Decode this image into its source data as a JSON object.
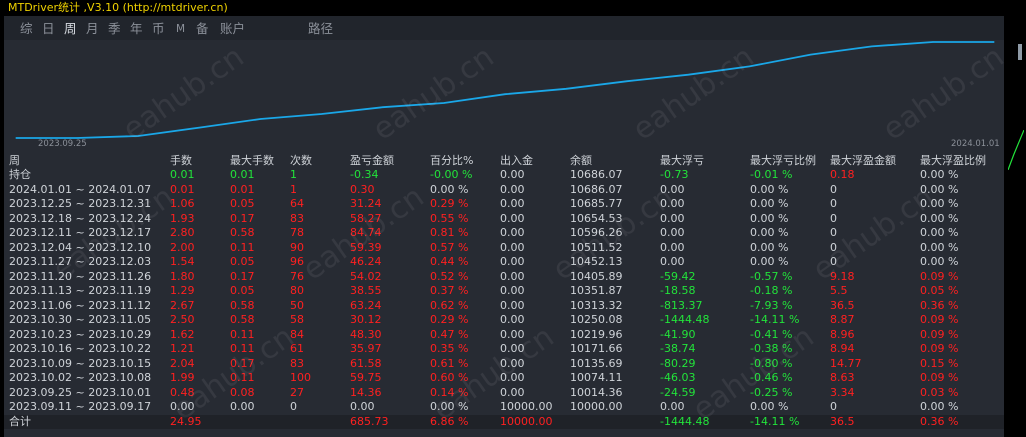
{
  "window": {
    "title": "MTDriver统计 ,V3.10 (http://mtdriver.cn)"
  },
  "tabs": [
    {
      "label": "综"
    },
    {
      "label": "日"
    },
    {
      "label": "周",
      "active": true
    },
    {
      "label": "月"
    },
    {
      "label": "季"
    },
    {
      "label": "年"
    },
    {
      "label": "币"
    },
    {
      "label": "M"
    },
    {
      "label": "备"
    },
    {
      "label": "账户"
    },
    {
      "label": "路径"
    }
  ],
  "chart_data": {
    "type": "line",
    "x_tick_labels": [
      "2023.09.25",
      "2024.01.01"
    ],
    "x": [
      "2023.09.11",
      "2023.09.25",
      "2023.10.02",
      "2023.10.09",
      "2023.10.16",
      "2023.10.23",
      "2023.10.30",
      "2023.11.06",
      "2023.11.13",
      "2023.11.20",
      "2023.11.27",
      "2023.12.04",
      "2023.12.11",
      "2023.12.18",
      "2023.12.25",
      "2024.01.01"
    ],
    "values": [
      10000.0,
      10000.0,
      10014.36,
      10074.11,
      10135.69,
      10171.66,
      10219.96,
      10250.08,
      10313.32,
      10351.87,
      10405.89,
      10452.13,
      10511.52,
      10596.26,
      10654.53,
      10685.77,
      10686.07
    ],
    "color": "#1aa7e8"
  },
  "table": {
    "headers": [
      "周",
      "手数",
      "最大手数",
      "次数",
      "盈亏金额",
      "百分比%",
      "出入金",
      "余额",
      "最大浮亏",
      "最大浮亏比例",
      "最大浮盈金额",
      "最大浮盈比例"
    ],
    "position_row": [
      "持仓",
      "0.01",
      "0.01",
      "1",
      "-0.34",
      "-0.00 %",
      "0.00",
      "10686.07",
      "-0.73",
      "-0.01 %",
      "0.18",
      "0.00 %"
    ],
    "rows": [
      [
        "2024.01.01 ~ 2024.01.07",
        "0.01",
        "0.01",
        "1",
        "0.30",
        "0.00 %",
        "0.00",
        "10686.07",
        "0.00",
        "0.00 %",
        "0",
        "0.00 %"
      ],
      [
        "2023.12.25 ~ 2023.12.31",
        "1.06",
        "0.05",
        "64",
        "31.24",
        "0.29 %",
        "0.00",
        "10685.77",
        "0.00",
        "0.00 %",
        "0",
        "0.00 %"
      ],
      [
        "2023.12.18 ~ 2023.12.24",
        "1.93",
        "0.17",
        "83",
        "58.27",
        "0.55 %",
        "0.00",
        "10654.53",
        "0.00",
        "0.00 %",
        "0",
        "0.00 %"
      ],
      [
        "2023.12.11 ~ 2023.12.17",
        "2.80",
        "0.58",
        "78",
        "84.74",
        "0.81 %",
        "0.00",
        "10596.26",
        "0.00",
        "0.00 %",
        "0",
        "0.00 %"
      ],
      [
        "2023.12.04 ~ 2023.12.10",
        "2.00",
        "0.11",
        "90",
        "59.39",
        "0.57 %",
        "0.00",
        "10511.52",
        "0.00",
        "0.00 %",
        "0",
        "0.00 %"
      ],
      [
        "2023.11.27 ~ 2023.12.03",
        "1.54",
        "0.05",
        "96",
        "46.24",
        "0.44 %",
        "0.00",
        "10452.13",
        "0.00",
        "0.00 %",
        "0",
        "0.00 %"
      ],
      [
        "2023.11.20 ~ 2023.11.26",
        "1.80",
        "0.17",
        "76",
        "54.02",
        "0.52 %",
        "0.00",
        "10405.89",
        "-59.42",
        "-0.57 %",
        "9.18",
        "0.09 %"
      ],
      [
        "2023.11.13 ~ 2023.11.19",
        "1.29",
        "0.05",
        "80",
        "38.55",
        "0.37 %",
        "0.00",
        "10351.87",
        "-18.58",
        "-0.18 %",
        "5.5",
        "0.05 %"
      ],
      [
        "2023.11.06 ~ 2023.11.12",
        "2.67",
        "0.58",
        "50",
        "63.24",
        "0.62 %",
        "0.00",
        "10313.32",
        "-813.37",
        "-7.93 %",
        "36.5",
        "0.36 %"
      ],
      [
        "2023.10.30 ~ 2023.11.05",
        "2.50",
        "0.58",
        "58",
        "30.12",
        "0.29 %",
        "0.00",
        "10250.08",
        "-1444.48",
        "-14.11 %",
        "8.87",
        "0.09 %"
      ],
      [
        "2023.10.23 ~ 2023.10.29",
        "1.62",
        "0.11",
        "84",
        "48.30",
        "0.47 %",
        "0.00",
        "10219.96",
        "-41.90",
        "-0.41 %",
        "8.96",
        "0.09 %"
      ],
      [
        "2023.10.16 ~ 2023.10.22",
        "1.21",
        "0.11",
        "61",
        "35.97",
        "0.35 %",
        "0.00",
        "10171.66",
        "-38.74",
        "-0.38 %",
        "8.94",
        "0.09 %"
      ],
      [
        "2023.10.09 ~ 2023.10.15",
        "2.04",
        "0.17",
        "83",
        "61.58",
        "0.61 %",
        "0.00",
        "10135.69",
        "-80.29",
        "-0.80 %",
        "14.77",
        "0.15 %"
      ],
      [
        "2023.10.02 ~ 2023.10.08",
        "1.99",
        "0.11",
        "100",
        "59.75",
        "0.60 %",
        "0.00",
        "10074.11",
        "-46.03",
        "-0.46 %",
        "8.63",
        "0.09 %"
      ],
      [
        "2023.09.25 ~ 2023.10.01",
        "0.48",
        "0.08",
        "27",
        "14.36",
        "0.14 %",
        "0.00",
        "10014.36",
        "-24.59",
        "-0.25 %",
        "3.34",
        "0.03 %"
      ],
      [
        "2023.09.11 ~ 2023.09.17",
        "0.00",
        "0.00",
        "0",
        "0.00",
        "0.00 %",
        "10000.00",
        "10000.00",
        "0.00",
        "0.00 %",
        "0",
        "0.00 %"
      ]
    ],
    "total_row": [
      "合计",
      "24.95",
      "",
      "",
      "685.73",
      "6.86 %",
      "10000.00",
      "",
      "-1444.48",
      "-14.11 %",
      "36.5",
      "0.36 %"
    ]
  },
  "watermark": "eahub.cn",
  "colors": {
    "title": "#f0d200",
    "positive": "#ff2020",
    "negative": "#22e33a",
    "line": "#1aa7e8"
  }
}
